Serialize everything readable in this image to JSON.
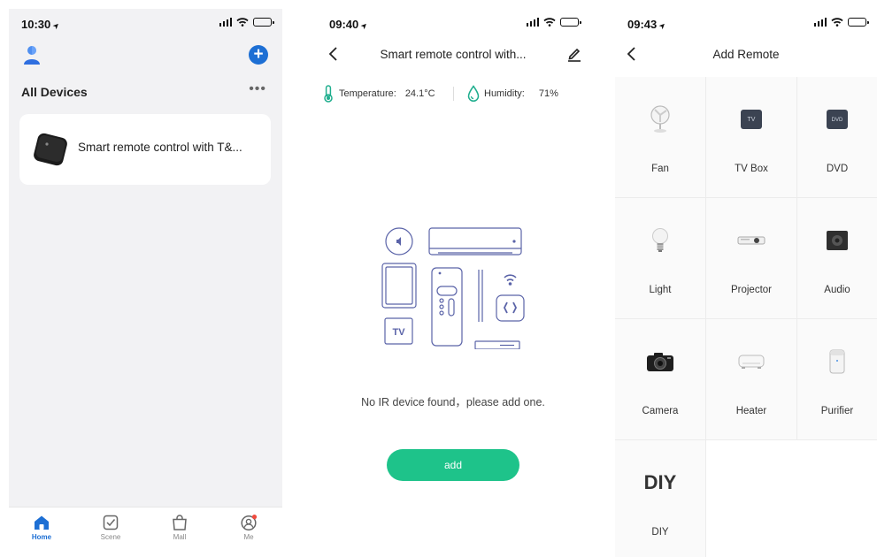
{
  "screen1": {
    "time": "10:30",
    "section_title": "All Devices",
    "more_label": "•••",
    "add_label": "+",
    "device": {
      "name": "Smart remote control with T&..."
    },
    "tabs": [
      {
        "label": "Home",
        "icon": "home-icon"
      },
      {
        "label": "Scene",
        "icon": "scene-checkbox-icon"
      },
      {
        "label": "Mall",
        "icon": "shopping-bag-icon"
      },
      {
        "label": "Me",
        "icon": "profile-icon"
      }
    ],
    "active_tab": "Home"
  },
  "screen2": {
    "time": "09:40",
    "title": "Smart remote control with...",
    "temperature": {
      "label": "Temperature:",
      "value": "24.1°C"
    },
    "humidity": {
      "label": "Humidity:",
      "value": "71%"
    },
    "empty_message": "No IR device found，please add one.",
    "add_button": "add",
    "illustration_tv_label": "TV"
  },
  "screen3": {
    "time": "09:43",
    "title": "Add Remote",
    "remotes": [
      {
        "label": "Fan",
        "icon": "fan-icon"
      },
      {
        "label": "TV Box",
        "icon": "tv-box-icon",
        "badge": "TV"
      },
      {
        "label": "DVD",
        "icon": "dvd-icon",
        "badge": "DVD"
      },
      {
        "label": "Light",
        "icon": "light-bulb-icon"
      },
      {
        "label": "Projector",
        "icon": "projector-icon"
      },
      {
        "label": "Audio",
        "icon": "speaker-icon"
      },
      {
        "label": "Camera",
        "icon": "camera-icon"
      },
      {
        "label": "Heater",
        "icon": "heater-icon"
      },
      {
        "label": "Purifier",
        "icon": "purifier-icon"
      },
      {
        "label": "DIY",
        "icon": "diy-icon",
        "badge": "DIY"
      }
    ]
  },
  "colors": {
    "accent_blue": "#1d6fd4",
    "accent_green": "#1ec38a",
    "teal_icon": "#1fae8e"
  }
}
